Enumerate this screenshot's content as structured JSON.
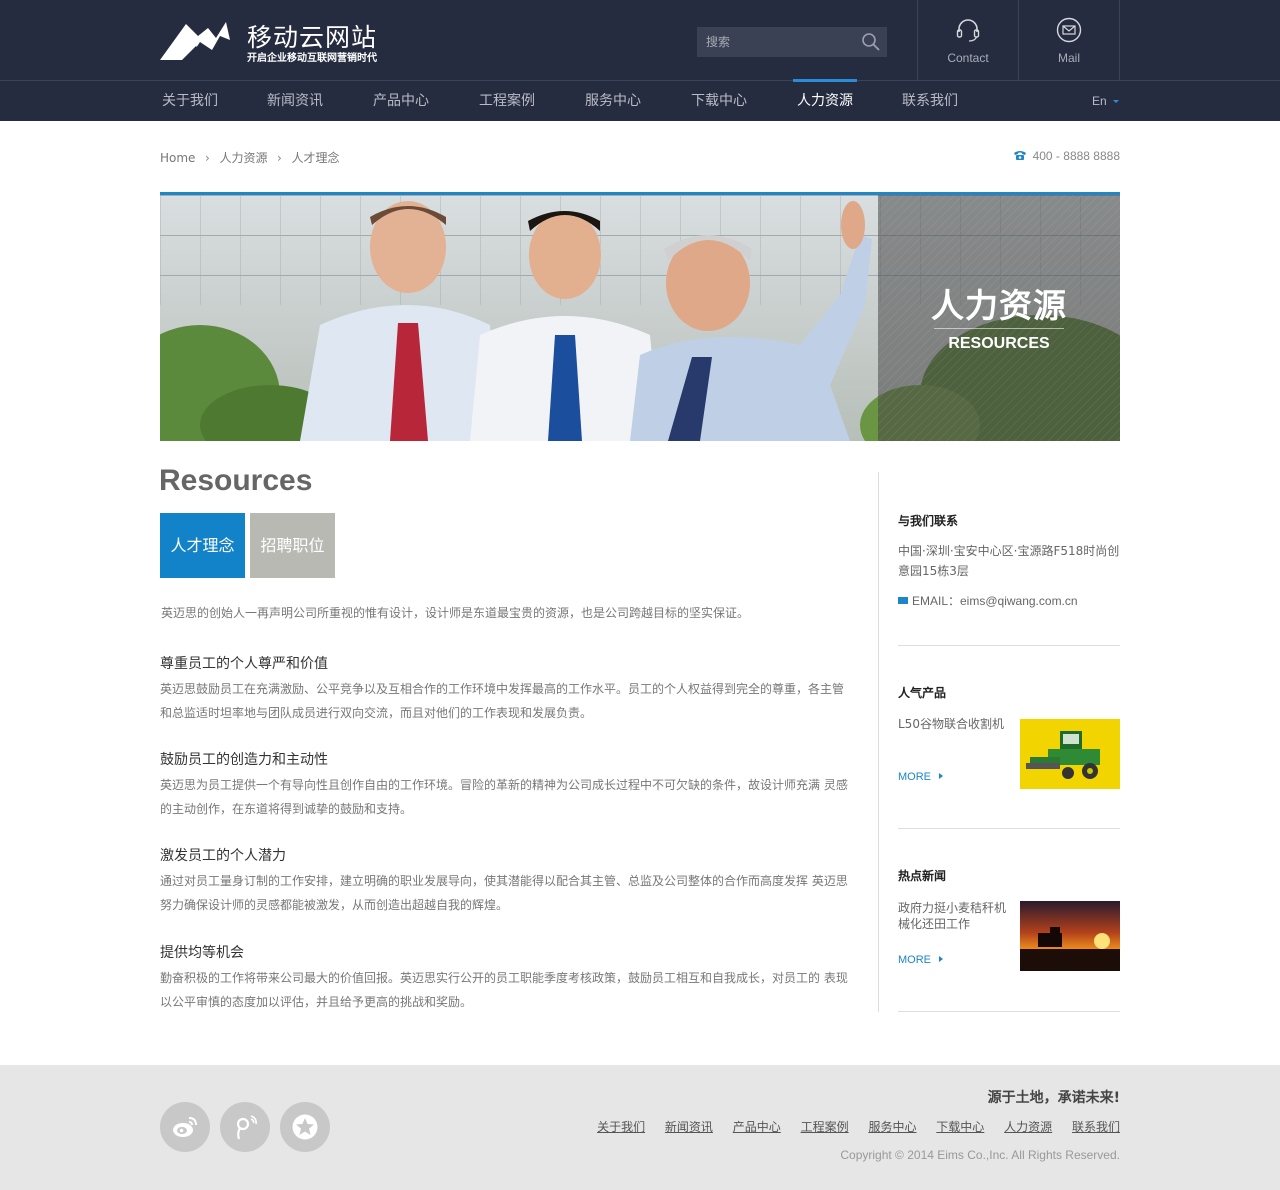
{
  "header": {
    "site_title": "移动云网站",
    "site_slogan": "开启企业移动互联网营销时代",
    "search": {
      "placeholder": "搜索",
      "value": ""
    },
    "contact_label": "Contact",
    "mail_label": "Mail"
  },
  "nav": {
    "items": [
      {
        "label": "关于我们"
      },
      {
        "label": "新闻资讯"
      },
      {
        "label": "产品中心"
      },
      {
        "label": "工程案例"
      },
      {
        "label": "服务中心"
      },
      {
        "label": "下载中心"
      },
      {
        "label": "人力资源",
        "active": true
      },
      {
        "label": "联系我们"
      }
    ],
    "lang": "En"
  },
  "breadcrumb": {
    "home": "Home",
    "level1": "人力资源",
    "level2": "人才理念"
  },
  "phone": "400 - 8888 8888",
  "banner": {
    "title_cn": "人力资源",
    "title_en": "RESOURCES"
  },
  "main": {
    "heading": "Resources",
    "tabs": [
      {
        "label": "人才理念",
        "active": true
      },
      {
        "label": "招聘职位",
        "active": false
      }
    ],
    "intro": "英迈思的创始人一再声明公司所重视的惟有设计，设计师是东道最宝贵的资源，也是公司跨越目标的坚实保证。",
    "sections": [
      {
        "title": "尊重员工的个人尊严和价值",
        "body": "英迈思鼓励员工在充满激励、公平竞争以及互相合作的工作环境中发挥最高的工作水平。员工的个人权益得到完全的尊重，各主管和总监适时坦率地与团队成员进行双向交流，而且对他们的工作表现和发展负责。"
      },
      {
        "title": "鼓励员工的创造力和主动性",
        "body": "英迈思为员工提供一个有导向性且创作自由的工作环境。冒险的革新的精神为公司成长过程中不可欠缺的条件，故设计师充满 灵感的主动创作，在东道将得到诚挚的鼓励和支持。"
      },
      {
        "title": "激发员工的个人潜力",
        "body": "通过对员工量身订制的工作安排，建立明确的职业发展导向，使其潜能得以配合其主管、总监及公司整体的合作而高度发挥 英迈思努力确保设计师的灵感都能被激发，从而创造出超越自我的辉煌。"
      },
      {
        "title": "提供均等机会",
        "body": "勤奋积极的工作将带来公司最大的价值回报。英迈思实行公开的员工职能季度考核政策，鼓励员工相互和自我成长，对员工的 表现以公平审慎的态度加以评估，并且给予更高的挑战和奖励。"
      }
    ]
  },
  "sidebar": {
    "contact": {
      "title": "与我们联系",
      "address": "中国·深圳·宝安中心区·宝源路F518时尚创意园15栋3层",
      "email": "EMAIL：eims@qiwang.com.cn"
    },
    "products": {
      "title": "人气产品",
      "item_title": "L50谷物联合收割机",
      "more": "MORE"
    },
    "news": {
      "title": "热点新闻",
      "item_title": "政府力挺小麦秸秆机械化还田工作",
      "more": "MORE"
    }
  },
  "footer": {
    "tagline": "源于土地，承诺未来!",
    "links": [
      "关于我们",
      "新闻资讯",
      "产品中心",
      "工程案例",
      "服务中心",
      "下载中心",
      "人力资源",
      "联系我们"
    ],
    "copyright": "Copyright © 2014  Eims Co.,Inc. All Rights Reserved."
  },
  "colors": {
    "header_bg": "#262c3f",
    "accent": "#1283c8",
    "tab_inactive": "#b9b9b3",
    "footer_bg": "#e6e6e6"
  },
  "icons": [
    "logo-mountain-icon",
    "search-icon",
    "headset-icon",
    "mail-icon",
    "phone-icon",
    "weibo-icon",
    "tencent-weibo-icon",
    "favorite-star-icon"
  ]
}
